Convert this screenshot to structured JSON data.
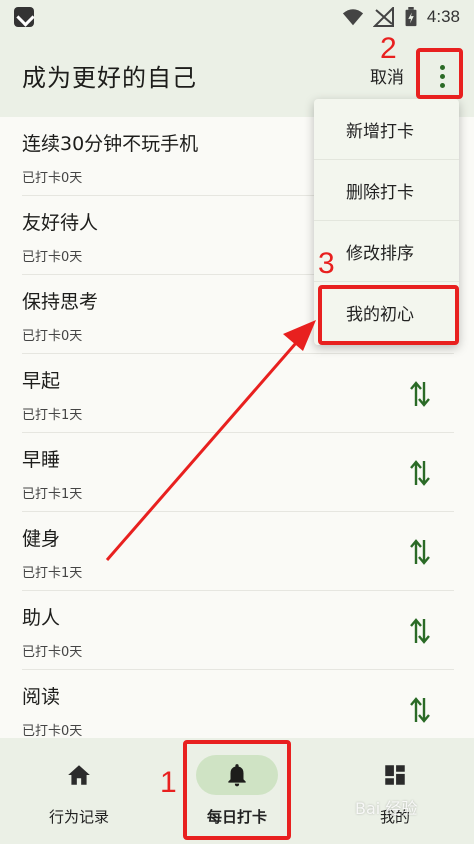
{
  "status_bar": {
    "time": "4:38"
  },
  "app_bar": {
    "title": "成为更好的自己",
    "cancel_label": "取消"
  },
  "habits": [
    {
      "title": "连续30分钟不玩手机",
      "subtitle": "已打卡0天"
    },
    {
      "title": "友好待人",
      "subtitle": "已打卡0天"
    },
    {
      "title": "保持思考",
      "subtitle": "已打卡0天"
    },
    {
      "title": "早起",
      "subtitle": "已打卡1天"
    },
    {
      "title": "早睡",
      "subtitle": "已打卡1天"
    },
    {
      "title": "健身",
      "subtitle": "已打卡1天"
    },
    {
      "title": "助人",
      "subtitle": "已打卡0天"
    },
    {
      "title": "阅读",
      "subtitle": "已打卡0天"
    }
  ],
  "menu": {
    "items": [
      "新增打卡",
      "删除打卡",
      "修改排序",
      "我的初心"
    ]
  },
  "bottom_nav": {
    "items": [
      "行为记录",
      "每日打卡",
      "我的"
    ],
    "active_index": 1
  },
  "annotations": [
    "1",
    "2",
    "3"
  ],
  "watermark": "Bai 经验",
  "colors": {
    "accent_green": "#2a6a26",
    "highlight_red": "#e8201f",
    "bar_bg": "#ebf0e6",
    "active_pill": "#cfe3c4"
  }
}
